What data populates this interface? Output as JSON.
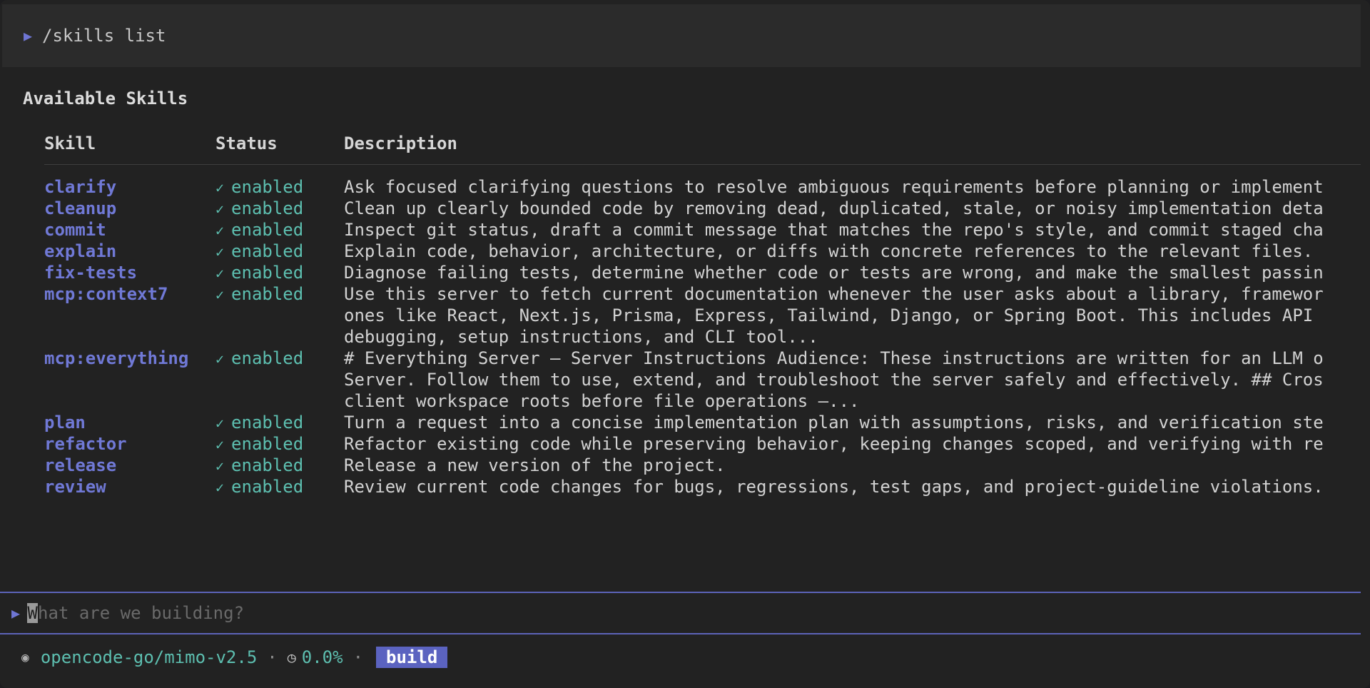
{
  "command": {
    "prompt_icon": "play-triangle-icon",
    "text": "/skills list"
  },
  "section_title": "Available Skills",
  "table": {
    "headers": {
      "skill": "Skill",
      "status": "Status",
      "description": "Description"
    },
    "rows": [
      {
        "skill": "clarify",
        "status": "enabled",
        "description": "Ask focused clarifying questions to resolve ambiguous requirements before planning or implement"
      },
      {
        "skill": "cleanup",
        "status": "enabled",
        "description": "Clean up clearly bounded code by removing dead, duplicated, stale, or noisy implementation deta"
      },
      {
        "skill": "commit",
        "status": "enabled",
        "description": "Inspect git status, draft a commit message that matches the repo's style, and commit staged cha"
      },
      {
        "skill": "explain",
        "status": "enabled",
        "description": "Explain code, behavior, architecture, or diffs with concrete references to the relevant files."
      },
      {
        "skill": "fix-tests",
        "status": "enabled",
        "description": "Diagnose failing tests, determine whether code or tests are wrong, and make the smallest passin"
      },
      {
        "skill": "mcp:context7",
        "status": "enabled",
        "description": "Use this server to fetch current documentation whenever the user asks about a library, framewor\nones like React, Next.js, Prisma, Express, Tailwind, Django, or Spring Boot. This includes API\ndebugging, setup instructions, and CLI tool..."
      },
      {
        "skill": "mcp:everything",
        "status": "enabled",
        "description": "# Everything Server – Server Instructions Audience: These instructions are written for an LLM o\nServer. Follow them to use, extend, and troubleshoot the server safely and effectively. ## Cros\nclient workspace roots before file operations –..."
      },
      {
        "skill": "plan",
        "status": "enabled",
        "description": "Turn a request into a concise implementation plan with assumptions, risks, and verification ste"
      },
      {
        "skill": "refactor",
        "status": "enabled",
        "description": "Refactor existing code while preserving behavior, keeping changes scoped, and verifying with re"
      },
      {
        "skill": "release",
        "status": "enabled",
        "description": "Release a new version of the project."
      },
      {
        "skill": "review",
        "status": "enabled",
        "description": "Review current code changes for bugs, regressions, test gaps, and project-guideline violations."
      }
    ]
  },
  "input": {
    "cursor_char": "W",
    "placeholder_rest": "hat are we building?"
  },
  "status_bar": {
    "model": "opencode-go/mimo-v2.5",
    "separator": "·",
    "usage": "0.0%",
    "mode": "build"
  },
  "colors": {
    "accent": "#5b63c0",
    "skill_name": "#7079d6",
    "enabled": "#5dbfb0",
    "background": "#222222"
  }
}
